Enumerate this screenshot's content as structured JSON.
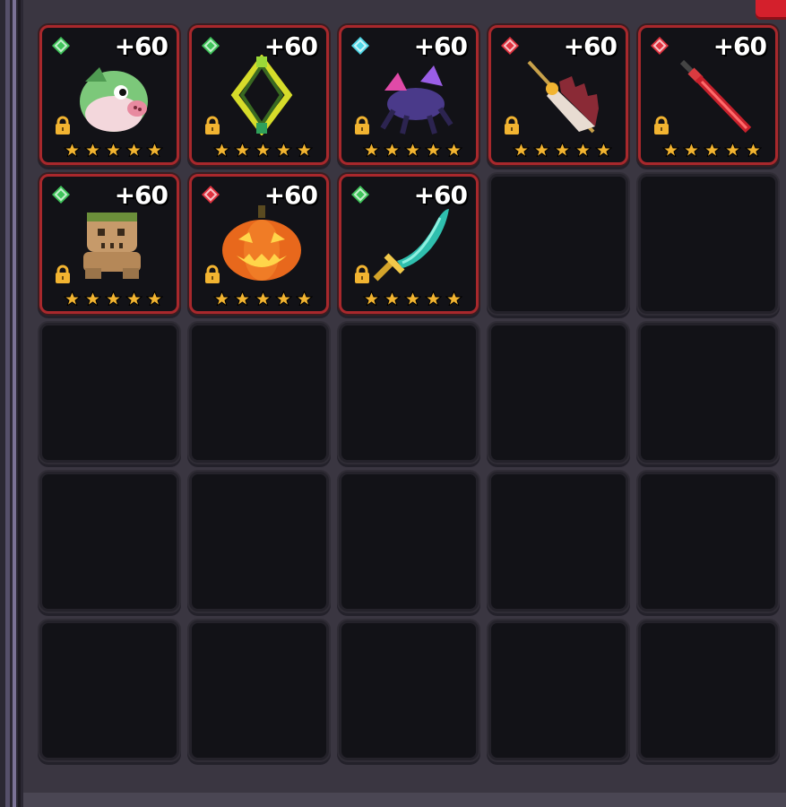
{
  "inventory": {
    "slots": [
      {
        "level": "+60",
        "gem": "green",
        "item": "piggy-bird",
        "stars": 5
      },
      {
        "level": "+60",
        "gem": "green",
        "item": "vine-bow",
        "stars": 5
      },
      {
        "level": "+60",
        "gem": "cyan",
        "item": "crystal-spider",
        "stars": 5
      },
      {
        "level": "+60",
        "gem": "red",
        "item": "serrated-staff",
        "stars": 5
      },
      {
        "level": "+60",
        "gem": "red",
        "item": "crimson-sword",
        "stars": 5
      },
      {
        "level": "+60",
        "gem": "green",
        "item": "wooden-totem",
        "stars": 5
      },
      {
        "level": "+60",
        "gem": "red",
        "item": "jack-o-lantern",
        "stars": 5
      },
      {
        "level": "+60",
        "gem": "green",
        "item": "jade-scimitar",
        "stars": 5
      }
    ],
    "total_slots": 25
  },
  "colors": {
    "gem_green": "#3fc45a",
    "gem_red": "#e0323f",
    "gem_cyan": "#4fd6e6",
    "frame_filled": "#a8282c",
    "star_gold": "#f2b431"
  }
}
